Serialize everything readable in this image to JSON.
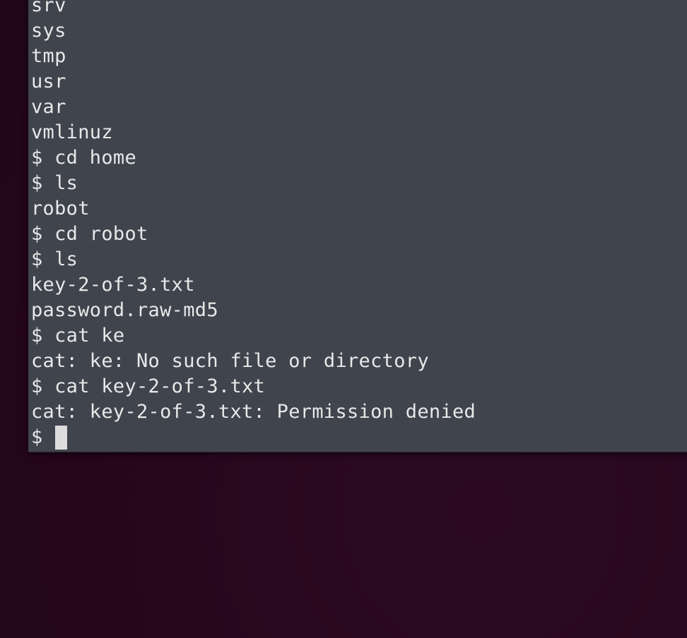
{
  "terminal": {
    "lines": [
      "srv",
      "sys",
      "tmp",
      "usr",
      "var",
      "vmlinuz",
      "$ cd home",
      "$ ls",
      "robot",
      "$ cd robot",
      "$ ls",
      "key-2-of-3.txt",
      "password.raw-md5",
      "$ cat ke",
      "cat: ke: No such file or directory",
      "$ cat key-2-of-3.txt",
      "cat: key-2-of-3.txt: Permission denied"
    ],
    "prompt": "$ "
  },
  "colors": {
    "terminal_bg": "#3f444d",
    "text": "#e8e8e8",
    "desktop_bg": "#2a0820",
    "cursor": "#dcdcdc"
  }
}
